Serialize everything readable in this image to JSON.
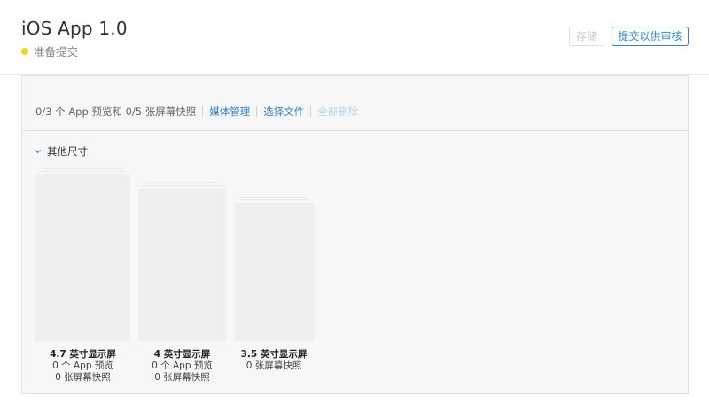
{
  "header": {
    "app_title": "iOS App 1.0",
    "status_text": "准备提交",
    "status_color": "#f5d60a",
    "save_label": "存储",
    "submit_label": "提交以供审核"
  },
  "media": {
    "count_text": "0/3 个 App 预览和 0/5 张屏幕快照",
    "manage_label": "媒体管理",
    "choose_file_label": "选择文件",
    "delete_all_label": "全部删除"
  },
  "section": {
    "title": "其他尺寸"
  },
  "devices": [
    {
      "name": "4.7 英寸显示屏",
      "previews": "0 个 App 预览",
      "screenshots": "0 张屏幕快照"
    },
    {
      "name": "4 英寸显示屏",
      "previews": "0 个 App 预览",
      "screenshots": "0 张屏幕快照"
    },
    {
      "name": "3.5 英寸显示屏",
      "previews": "",
      "screenshots": "0 张屏幕快照"
    }
  ],
  "colors": {
    "accent": "#2f84cf",
    "disabled_link": "#b8d2ea",
    "panel_bg": "#f7f7f7"
  }
}
